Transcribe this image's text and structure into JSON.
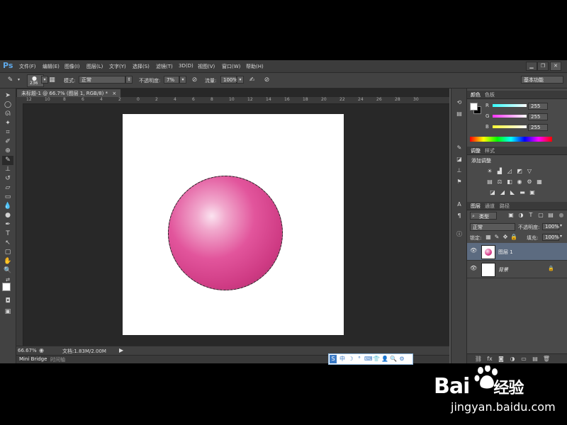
{
  "app": {
    "logo": "Ps",
    "menu": [
      "文件(F)",
      "编辑(E)",
      "图像(I)",
      "图层(L)",
      "文字(Y)",
      "选择(S)",
      "滤镜(T)",
      "3D(D)",
      "视图(V)",
      "窗口(W)",
      "帮助(H)"
    ],
    "window_controls": [
      "▁",
      "❐",
      "✕"
    ]
  },
  "options": {
    "brush_size": "236",
    "mode_label": "模式:",
    "mode_value": "正常",
    "opacity_label": "不透明度:",
    "opacity_value": "7%",
    "flow_label": "流量:",
    "flow_value": "100%",
    "workspace": "基本功能"
  },
  "document": {
    "tab_title": "未标题-1 @ 66.7% (图层 1, RGB/8) *",
    "tab_close": "×",
    "ruler_marks": [
      "12",
      "10",
      "8",
      "6",
      "4",
      "2",
      "0",
      "2",
      "4",
      "6",
      "8",
      "10",
      "12",
      "14",
      "16",
      "18",
      "20",
      "22",
      "24",
      "26",
      "28",
      "30"
    ],
    "zoom": "66.67%",
    "doc_info": "文档:1.83M/2.00M"
  },
  "bottom_tabs": [
    "Mini Bridge",
    "时间轴"
  ],
  "ime": [
    "中",
    "☽",
    "°",
    "⌨",
    "👕",
    "👤",
    "🔍",
    "⚙"
  ],
  "color_panel": {
    "tabs": [
      "颜色",
      "色板"
    ],
    "channels": [
      {
        "label": "R",
        "value": "255",
        "color": "#e0304a"
      },
      {
        "label": "G",
        "value": "255",
        "color": "#d040d0"
      },
      {
        "label": "B",
        "value": "255",
        "color": "#e8e040"
      }
    ]
  },
  "adjust_panel": {
    "tabs": [
      "调整",
      "样式"
    ],
    "title": "添加调整"
  },
  "layers_panel": {
    "tabs": [
      "图层",
      "通道",
      "路径"
    ],
    "filter_kind": "类型",
    "blend_mode": "正常",
    "opacity_label": "不透明度:",
    "opacity_value": "100%",
    "lock_label": "锁定:",
    "fill_label": "填充:",
    "fill_value": "100%",
    "layers": [
      {
        "name": "图层 1",
        "selected": true
      },
      {
        "name": "背景",
        "selected": false,
        "locked": true
      }
    ]
  },
  "watermark": {
    "brand": "Bai",
    "brand_cn": "经验",
    "url": "jingyan.baidu.com"
  },
  "colors": {
    "sphere": "#d83c8c",
    "panel_bg": "#4a4a4a",
    "selected_layer": "#5c6b80"
  }
}
